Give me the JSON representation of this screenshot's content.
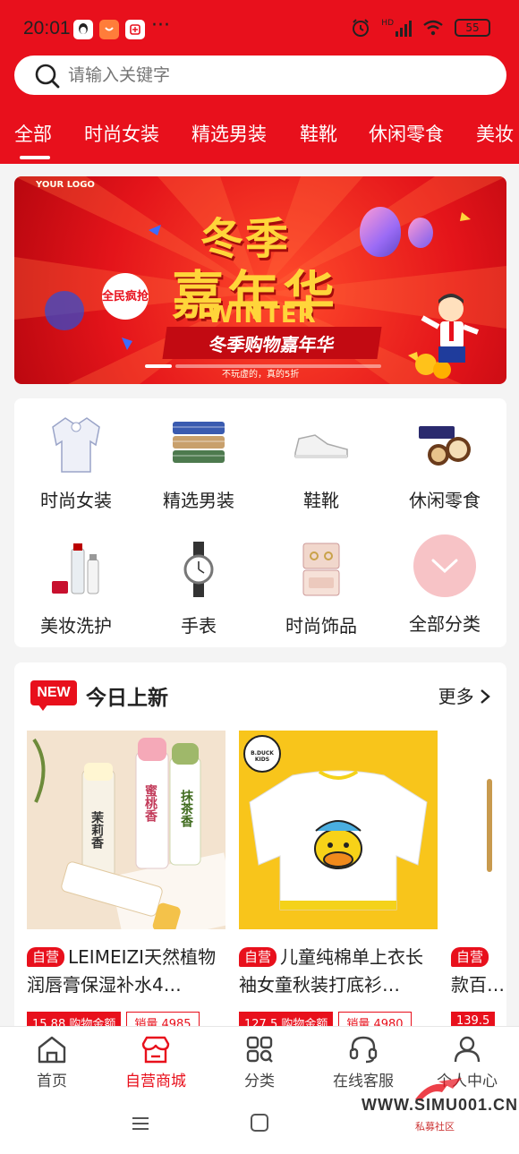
{
  "status_bar": {
    "time": "20:01",
    "battery": "55",
    "dots": "···",
    "signal": "HD"
  },
  "search": {
    "placeholder": "请输入关键字"
  },
  "category_tabs": [
    "全部",
    "时尚女装",
    "精选男装",
    "鞋靴",
    "休闲零食",
    "美妆"
  ],
  "banner": {
    "logo": "YOUR LOGO",
    "title_line1": "冬季",
    "title_line2": "嘉年华",
    "subtitle_en": "WINTER",
    "ribbon": "冬季购物嘉年华",
    "badge": "全民疯抢",
    "small_print": "不玩虚的，真的5折"
  },
  "categories": [
    {
      "label": "时尚女装",
      "icon": "blouse-icon"
    },
    {
      "label": "精选男装",
      "icon": "shirts-icon"
    },
    {
      "label": "鞋靴",
      "icon": "sneaker-icon"
    },
    {
      "label": "休闲零食",
      "icon": "cookies-icon"
    },
    {
      "label": "美妆洗护",
      "icon": "cosmetics-icon"
    },
    {
      "label": "手表",
      "icon": "watch-icon"
    },
    {
      "label": "时尚饰品",
      "icon": "jewelry-box-icon"
    },
    {
      "label": "全部分类",
      "icon": "chevron-down-icon"
    }
  ],
  "new_arrivals": {
    "badge": "NEW",
    "title": "今日上新",
    "more": "更多",
    "products": [
      {
        "tag": "自营",
        "title": "LEIMEIZI天然植物润唇膏保湿补水4…",
        "price": "15.88 购物金额",
        "sales": "销量 4985",
        "image_text": [
          "茉莉香",
          "蜜桃香",
          "抹茶香"
        ]
      },
      {
        "tag": "自营",
        "title": "儿童纯棉单上衣长袖女童秋装打底衫…",
        "price": "127.5 购物金额",
        "sales": "销量 4980",
        "image_text": [
          "B.DUCK KIDS"
        ]
      },
      {
        "tag": "自营",
        "title": "款百…",
        "price": "139.5",
        "sales": ""
      }
    ]
  },
  "bottom_nav": [
    {
      "label": "首页",
      "icon": "home-icon",
      "active": false
    },
    {
      "label": "自营商城",
      "icon": "store-icon",
      "active": true
    },
    {
      "label": "分类",
      "icon": "category-icon",
      "active": false
    },
    {
      "label": "在线客服",
      "icon": "headset-icon",
      "active": false
    },
    {
      "label": "个人中心",
      "icon": "user-icon",
      "active": false
    }
  ],
  "watermark": {
    "text": "WWW.SIMU001.CN",
    "sub": "私募社区"
  },
  "colors": {
    "brand_red": "#e8101c",
    "soft_pink": "#f7c3c6"
  }
}
